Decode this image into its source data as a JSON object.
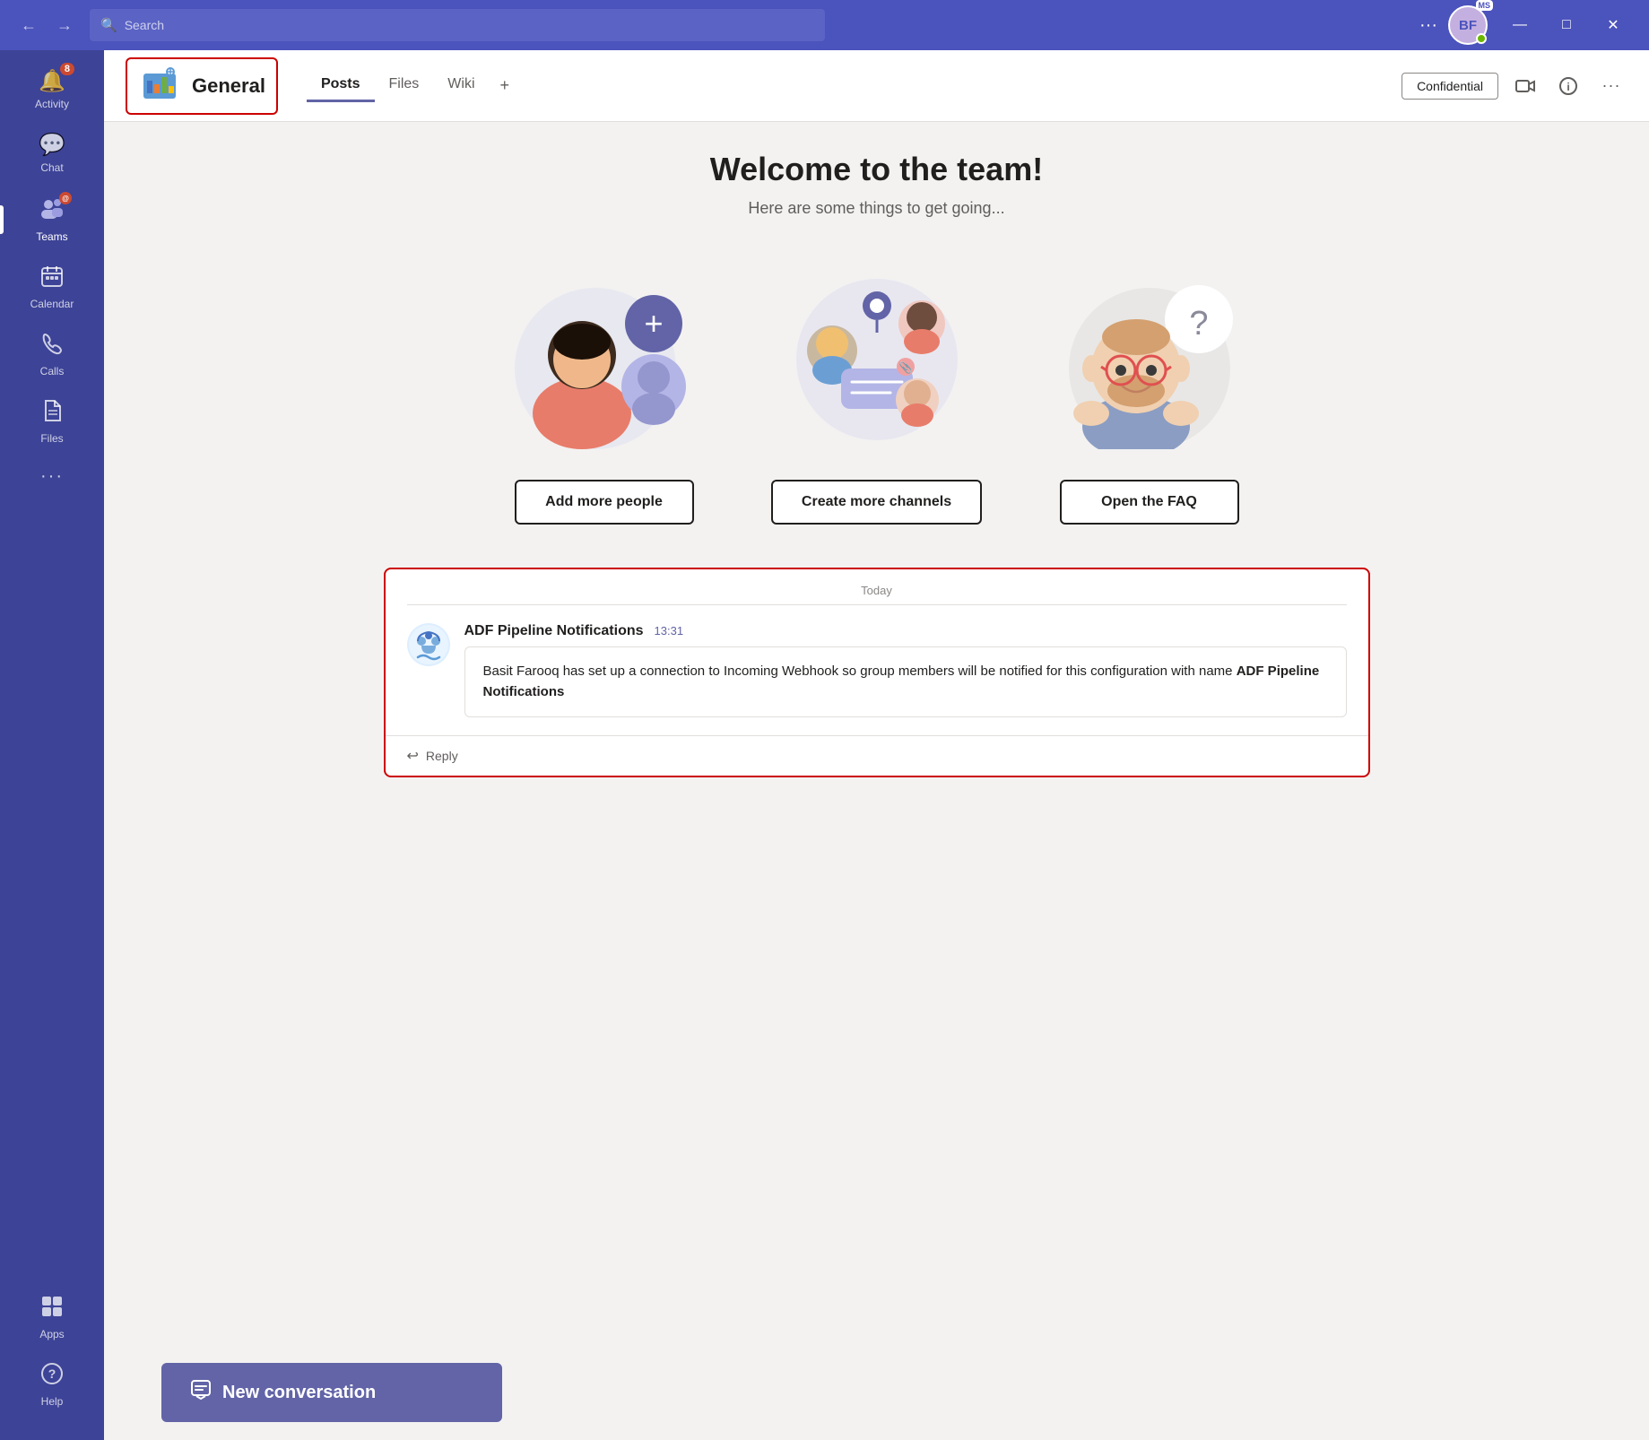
{
  "titlebar": {
    "back_label": "←",
    "forward_label": "→",
    "search_placeholder": "Search",
    "more_label": "···",
    "avatar_initials": "BF",
    "ms_badge": "MS",
    "minimize_label": "—",
    "maximize_label": "□",
    "close_label": "✕"
  },
  "sidebar": {
    "items": [
      {
        "id": "activity",
        "label": "Activity",
        "icon": "🔔",
        "badge": "8",
        "active": false
      },
      {
        "id": "chat",
        "label": "Chat",
        "icon": "💬",
        "badge": "",
        "active": false
      },
      {
        "id": "teams",
        "label": "Teams",
        "icon": "👥",
        "badge_dot": true,
        "active": true
      },
      {
        "id": "calendar",
        "label": "Calendar",
        "icon": "📅",
        "active": false
      },
      {
        "id": "calls",
        "label": "Calls",
        "icon": "📞",
        "active": false
      },
      {
        "id": "files",
        "label": "Files",
        "icon": "📄",
        "active": false
      },
      {
        "id": "more",
        "label": "···",
        "active": false
      }
    ],
    "bottom_items": [
      {
        "id": "apps",
        "label": "Apps",
        "icon": "⊞"
      },
      {
        "id": "help",
        "label": "Help",
        "icon": "?"
      }
    ]
  },
  "channel": {
    "name": "General",
    "icon": "📊",
    "tabs": [
      {
        "id": "posts",
        "label": "Posts",
        "active": true
      },
      {
        "id": "files",
        "label": "Files",
        "active": false
      },
      {
        "id": "wiki",
        "label": "Wiki",
        "active": false
      }
    ],
    "add_tab_label": "+",
    "confidential_label": "Confidential"
  },
  "welcome": {
    "title": "Welcome to the team!",
    "subtitle": "Here are some things to get going..."
  },
  "actions": [
    {
      "id": "add-people",
      "label": "Add more people"
    },
    {
      "id": "create-channels",
      "label": "Create more channels"
    },
    {
      "id": "open-faq",
      "label": "Open the FAQ"
    }
  ],
  "messages": {
    "date_label": "Today",
    "thread": {
      "sender": "ADF Pipeline Notifications",
      "time": "13:31",
      "text": "Basit Farooq has set up a connection to Incoming Webhook so group members will be notified for this configuration with name ",
      "bold_text": "ADF Pipeline Notifications",
      "reply_label": "Reply"
    }
  },
  "new_conversation": {
    "label": "New conversation",
    "icon": "✎"
  }
}
